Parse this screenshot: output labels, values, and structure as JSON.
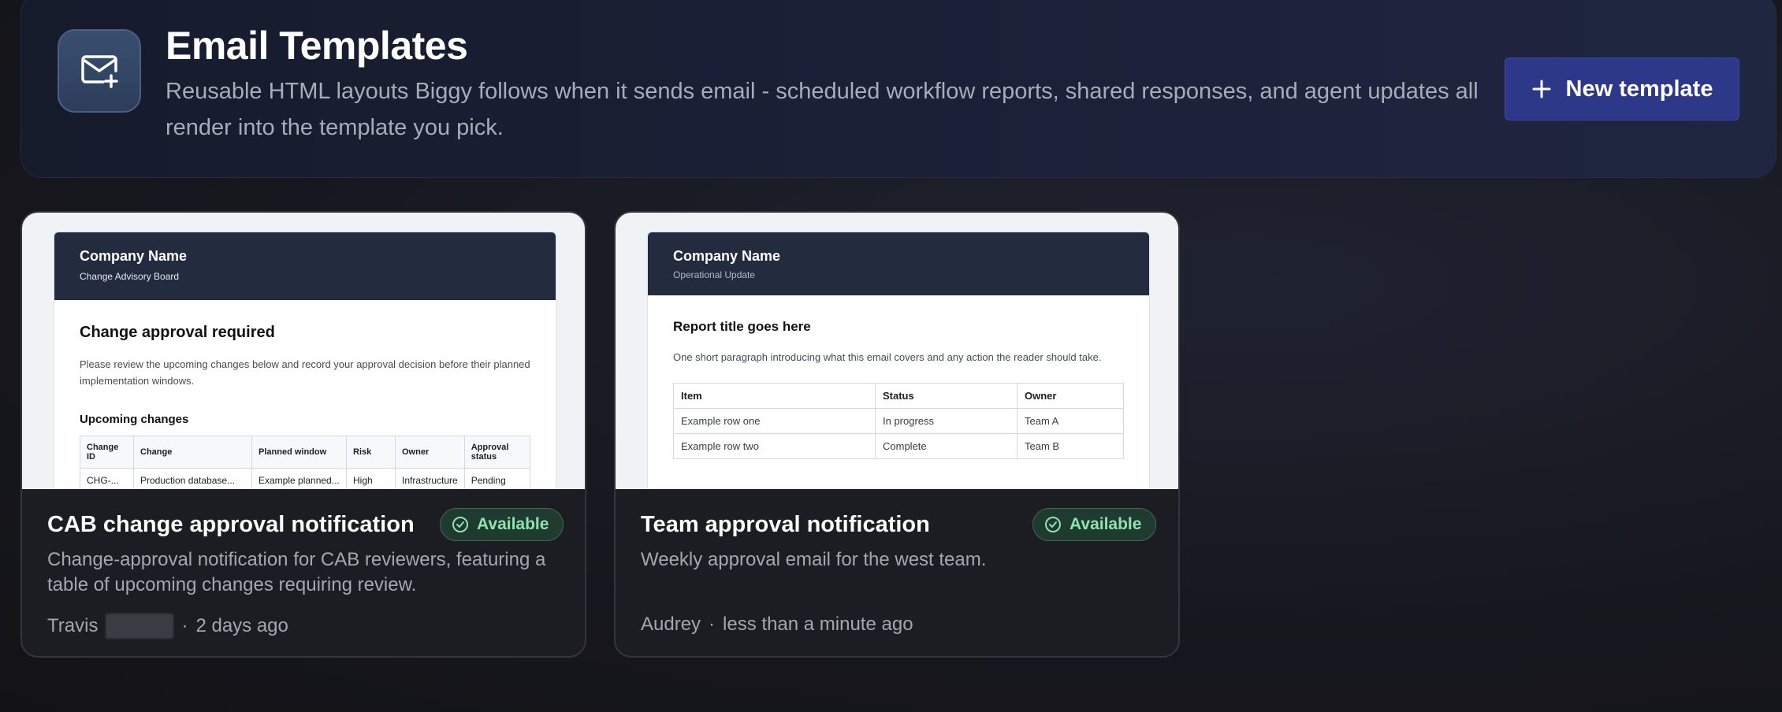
{
  "header": {
    "icon": "mail-plus-icon",
    "title": "Email Templates",
    "description": "Reusable HTML layouts Biggy follows when it sends email - scheduled workflow reports, shared responses, and agent updates all render into the template you pick.",
    "new_button_label": "New template"
  },
  "cards": [
    {
      "title": "CAB change approval notification",
      "badge": "Available",
      "description": "Change-approval notification for CAB reviewers, featuring a table of upcoming changes requiring review.",
      "author": "Travis",
      "time": "2 days ago",
      "preview": {
        "company": "Company Name",
        "subtitle": "Change Advisory Board",
        "heading": "Change approval required",
        "paragraph": "Please review the upcoming changes below and record your approval decision before their planned implementation windows.",
        "section": "Upcoming changes",
        "columns": [
          "Change ID",
          "Change",
          "Planned window",
          "Risk",
          "Owner",
          "Approval status"
        ],
        "rows": [
          [
            "CHG-...",
            "Production database...",
            "Example planned...",
            "High",
            "Infrastructure",
            "Pending"
          ]
        ]
      }
    },
    {
      "title": "Team approval notification",
      "badge": "Available",
      "description": "Weekly approval email for the west team.",
      "author": "Audrey",
      "time": "less than a minute ago",
      "preview": {
        "company": "Company Name",
        "subtitle": "Operational Update",
        "heading": "Report title goes here",
        "paragraph": "One short paragraph introducing what this email covers and any action the reader should take.",
        "columns": [
          "Item",
          "Status",
          "Owner"
        ],
        "rows": [
          [
            "Example row one",
            "In progress",
            "Team A"
          ],
          [
            "Example row two",
            "Complete",
            "Team B"
          ]
        ]
      }
    }
  ],
  "colors": {
    "accent_button": "#2d3888",
    "badge_green": "#8fe3b0"
  }
}
